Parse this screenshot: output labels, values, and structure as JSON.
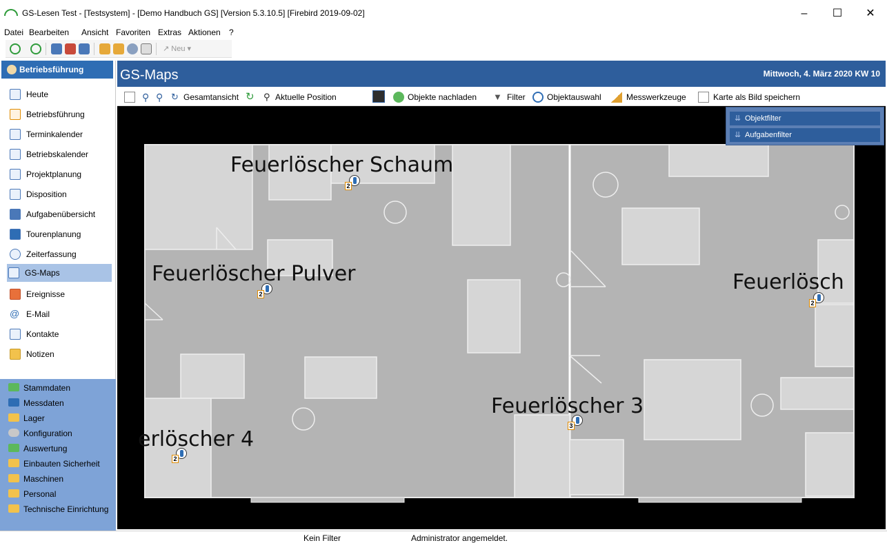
{
  "window": {
    "title": "GS-Lesen Test - [Testsystem] - [Demo Handbuch GS]  [Version  5.3.10.5]  [Firebird 2019-09-02]",
    "minimize": "–",
    "maximize": "☐",
    "close": "✕"
  },
  "menu": [
    "Datei",
    "Bearbeiten",
    "Ansicht",
    "Favoriten",
    "Extras",
    "Aktionen",
    "?"
  ],
  "toolbar": {
    "neu_label": "Neu"
  },
  "sidebar": {
    "header": "Betriebsführung",
    "items": [
      {
        "label": "Heute"
      },
      {
        "label": "Betriebsführung"
      },
      {
        "label": "Terminkalender"
      },
      {
        "label": "Betriebskalender"
      },
      {
        "label": "Projektplanung"
      },
      {
        "label": "Disposition"
      },
      {
        "label": "Aufgabenübersicht"
      },
      {
        "label": "Tourenplanung"
      },
      {
        "label": "Zeiterfassung"
      },
      {
        "label": "GS-Maps",
        "selected": true
      },
      {
        "label": "Ereignisse"
      },
      {
        "label": "E-Mail"
      },
      {
        "label": "Kontakte"
      },
      {
        "label": "Notizen"
      }
    ],
    "lower_items": [
      "Stammdaten",
      "Messdaten",
      "Lager",
      "Konfiguration",
      "Auswertung",
      "Einbauten Sicherheit",
      "Maschinen",
      "Personal",
      "Technische Einrichtung"
    ]
  },
  "main": {
    "title": "GS-Maps",
    "date": "Mittwoch, 4. März 2020  KW 10"
  },
  "maptoolbar": {
    "gesamtansicht": "Gesamtansicht",
    "aktuelle_position": "Aktuelle Position",
    "objekte_nachladen": "Objekte nachladen",
    "filter": "Filter",
    "objektauswahl": "Objektauswahl",
    "messwerkzeuge": "Messwerkzeuge",
    "karte_speichern": "Karte als Bild speichern"
  },
  "filterpanel": {
    "objektfilter": "Objektfilter",
    "aufgabenfilter": "Aufgabenfilter"
  },
  "map": {
    "labels": [
      "Feuerlöscher Schaum",
      "Feuerlöscher Pulver",
      "Feuerlösch",
      "Feuerlöscher 3",
      "erlöscher 4"
    ],
    "marker_numbers": [
      "2",
      "2",
      "2",
      "3",
      "2"
    ]
  },
  "status": {
    "filter": "Kein Filter",
    "user": "Administrator angemeldet."
  },
  "colors": {
    "accent": "#2e5e9c",
    "sidebar_selected": "#a9c3e6",
    "sidebar_lower": "#7ea3d7",
    "map_bg": "#000000",
    "floor": "#b4b4b4"
  }
}
